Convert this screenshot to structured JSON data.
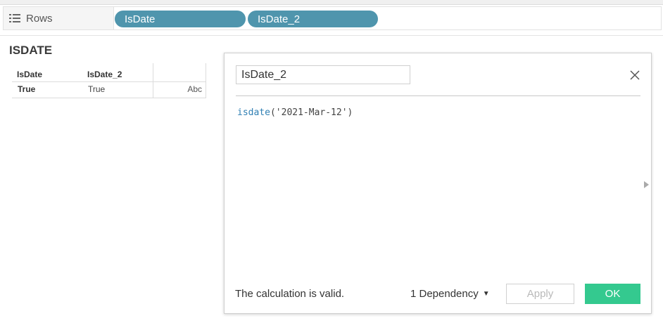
{
  "shelf": {
    "label": "Rows",
    "pills": [
      "IsDate",
      "IsDate_2"
    ]
  },
  "sheet": {
    "title": "ISDATE",
    "table": {
      "headers": [
        "IsDate",
        "IsDate_2"
      ],
      "row": [
        "True",
        "True",
        "Abc"
      ]
    }
  },
  "dialog": {
    "name_value": "IsDate_2",
    "formula_fn": "isdate",
    "formula_args": "('2021-Mar-12')",
    "status": "The calculation is valid.",
    "dependency": "1 Dependency",
    "apply_label": "Apply",
    "ok_label": "OK"
  },
  "colors": {
    "pill": "#4f95ad",
    "ok_button": "#34c98f",
    "function_text": "#2f7fb3"
  },
  "icons": {
    "rows": "rows-list-icon",
    "close": "close-icon",
    "dropdown": "caret-down-icon",
    "expand": "triangle-right-icon"
  }
}
